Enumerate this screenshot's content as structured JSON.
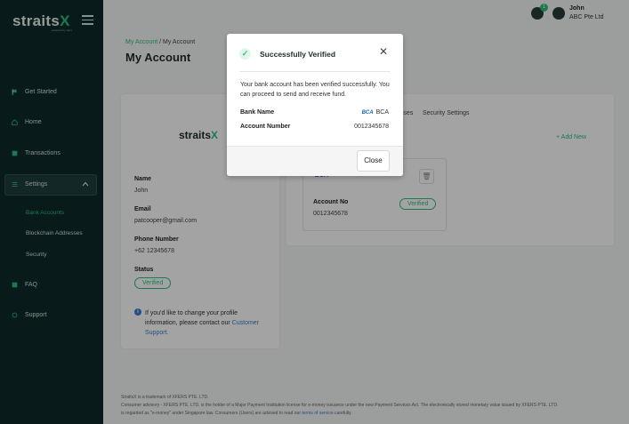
{
  "brand": {
    "name_main": "straits",
    "name_x": "X",
    "tagline": "powered by xfers"
  },
  "sidebar": {
    "items": [
      {
        "label": "Get Started",
        "icon": "flag-icon"
      },
      {
        "label": "Home",
        "icon": "home-icon"
      },
      {
        "label": "Transactions",
        "icon": "transactions-icon"
      },
      {
        "label": "Settings",
        "icon": "settings-icon"
      },
      {
        "label": "FAQ",
        "icon": "faq-icon"
      },
      {
        "label": "Support",
        "icon": "support-icon"
      }
    ],
    "settings_sub": [
      "Bank Accounts",
      "Blockchain Addresses",
      "Security"
    ]
  },
  "header": {
    "notification_count": "1",
    "user_name": "John",
    "user_company": "ABC Pte Ltd"
  },
  "breadcrumb": {
    "parent": "My Account",
    "separator": " / ",
    "current": "My Account"
  },
  "page_title": "My Account",
  "profile": {
    "name_label": "Name",
    "name_value": "John",
    "email_label": "Email",
    "email_value": "patcooper@gmail.com",
    "phone_label": "Phone Number",
    "phone_value": "+62 12345678",
    "status_label": "Status",
    "status_value": "Verified",
    "info_text": "If you'd like to change your profile information, please contact our ",
    "info_link": "Customer Support."
  },
  "tabs": {
    "partial": "sses",
    "security": "Security Settings"
  },
  "add_new": "+ Add New",
  "bank_card": {
    "account_no_label": "Account No",
    "account_no_value": "0012345678",
    "status": "Verified",
    "logo": "BCA"
  },
  "footer": {
    "line1": "StraitsX is a trademark of XFERS PTE. LTD.",
    "line2": "Consumer advisory - XFERS PTE. LTD. is the holder of a Major Payment Institution license for e-money issuance under the new Payment Services Act. The electronically stored monetary value issued by XFERS PTE. LTD.",
    "line3": "is regarded as \"e-money\" under Singapore law. Consumers (Users) are advised to read our ",
    "line3_link": "terms of service",
    "line3_end": " carefully."
  },
  "modal": {
    "title": "Successfully Verified",
    "message": "Your bank account has been verified successfully. You can proceed to send and receive fund.",
    "bank_name_label": "Bank Name",
    "bank_name_logo": "BCA",
    "bank_name_value": "BCA",
    "account_number_label": "Account Number",
    "account_number_value": "0012345678",
    "close_label": "Close"
  }
}
